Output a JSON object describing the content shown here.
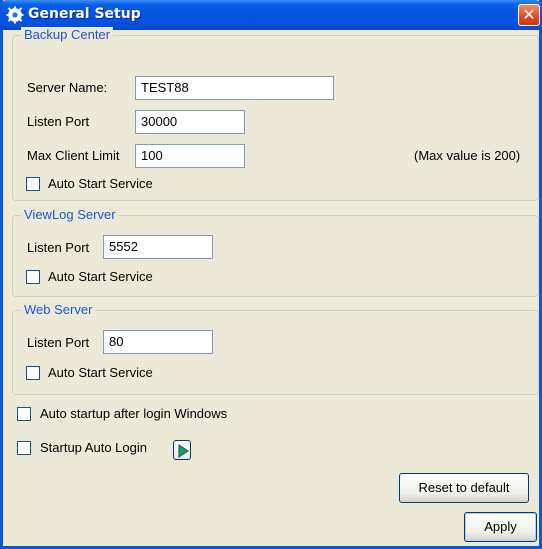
{
  "window": {
    "title": "General Setup",
    "close_glyph": "✕"
  },
  "backup_center": {
    "title": "Backup Center",
    "server_name_label": "Server Name:",
    "server_name_value": "TEST88",
    "listen_port_label": "Listen Port",
    "listen_port_value": "30000",
    "max_client_label": "Max Client Limit",
    "max_client_value": "100",
    "max_hint": "(Max value is 200)",
    "auto_start_label": "Auto Start Service",
    "auto_start_checked": false
  },
  "viewlog_server": {
    "title": "ViewLog Server",
    "listen_port_label": "Listen Port",
    "listen_port_value": "5552",
    "auto_start_label": "Auto Start Service",
    "auto_start_checked": false
  },
  "web_server": {
    "title": "Web Server",
    "listen_port_label": "Listen Port",
    "listen_port_value": "80",
    "auto_start_label": "Auto Start Service",
    "auto_start_checked": false
  },
  "options": {
    "auto_startup_label": "Auto startup after login Windows",
    "auto_startup_checked": false,
    "startup_login_label": "Startup Auto Login",
    "startup_login_checked": false
  },
  "buttons": {
    "reset_label": "Reset to default",
    "apply_label": "Apply"
  },
  "colors": {
    "titlebar": "#0254e1",
    "group_title": "#2255cc",
    "dialog_bg": "#ece9d8"
  }
}
